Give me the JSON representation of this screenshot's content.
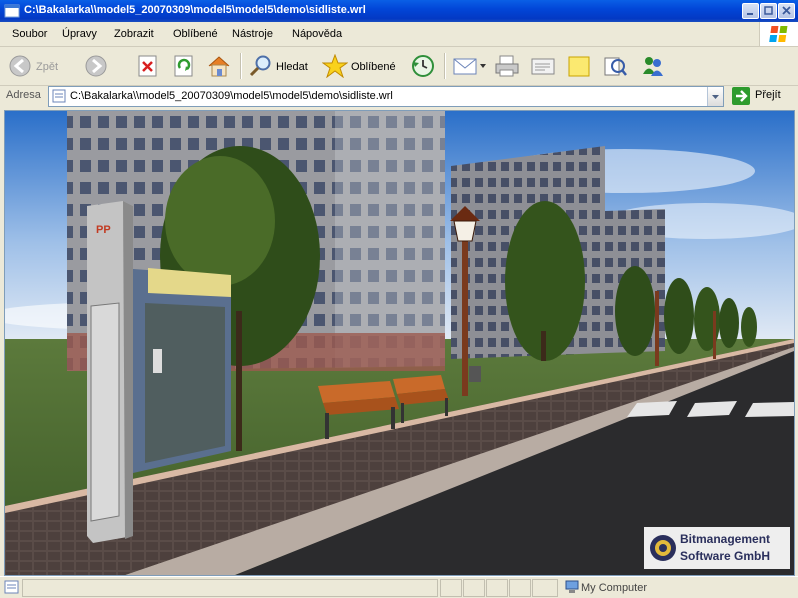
{
  "window": {
    "title": "C:\\Bakalarka\\\\model5_20070309\\model5\\model5\\demo\\sidliste.wrl"
  },
  "menu": {
    "items": [
      "Soubor",
      "Úpravy",
      "Zobrazit",
      "Oblíbené",
      "Nástroje",
      "Nápověda"
    ]
  },
  "toolbar": {
    "back_label": "Zpět",
    "search_label": "Hledat",
    "favorites_label": "Oblíbené"
  },
  "address": {
    "label": "Adresa",
    "url": "C:\\Bakalarka\\\\model5_20070309\\model5\\model5\\demo\\sidliste.wrl",
    "go_label": "Přejít"
  },
  "viewer": {
    "logo_line1": "Bitmanagement",
    "logo_line2": "Software GmbH",
    "phone_sign": "PP"
  },
  "status": {
    "text": "",
    "zone": "My Computer"
  },
  "colors": {
    "titlebar": "#0246d8",
    "go_arrow": "#2e9b2e",
    "sky": "#c9d8ec",
    "grass": "#4e6e36",
    "road": "#2b2b2d"
  }
}
